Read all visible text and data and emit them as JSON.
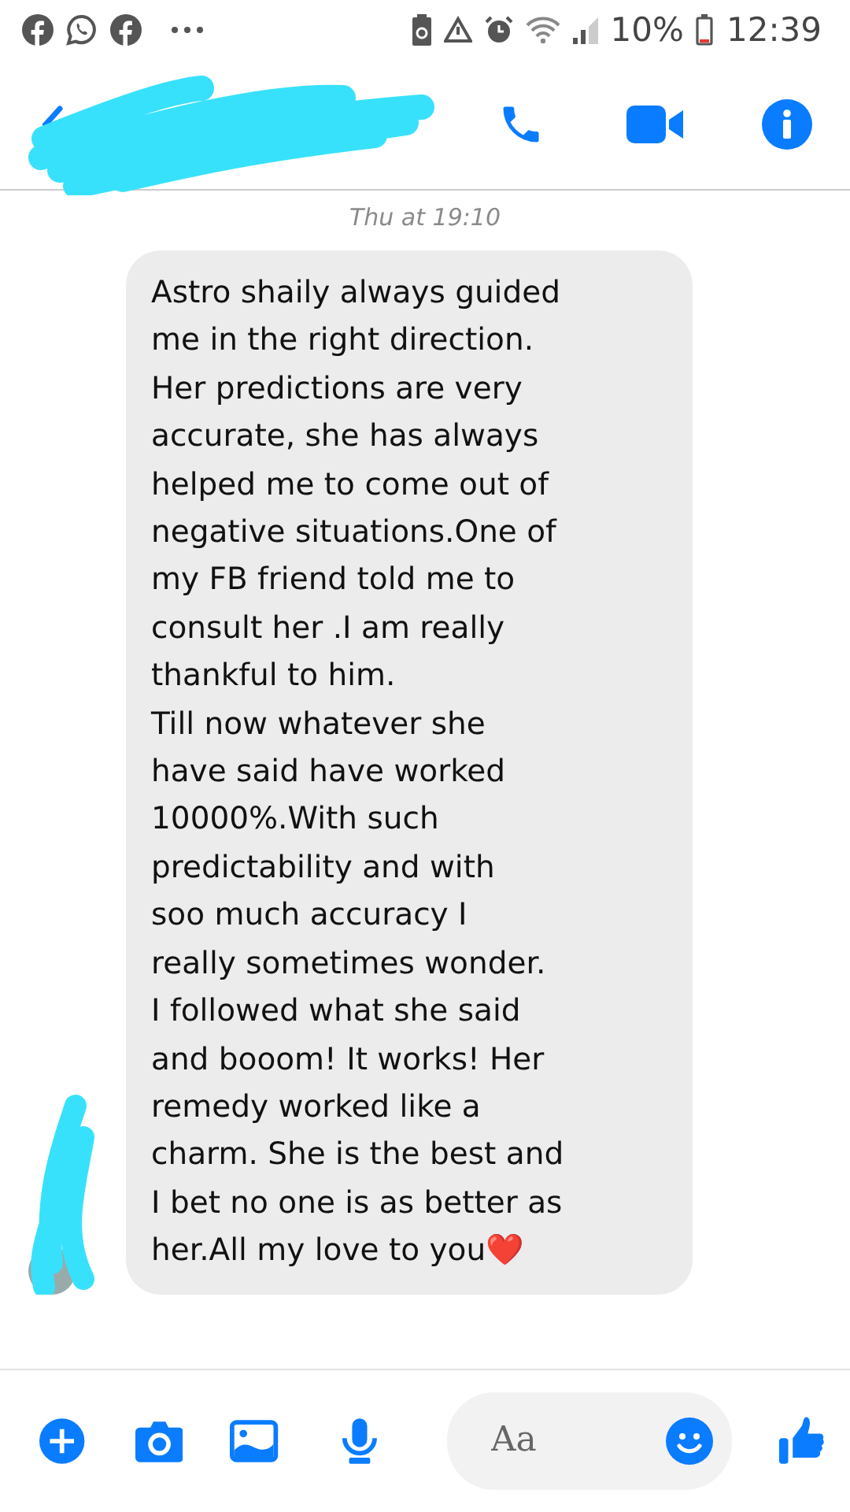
{
  "status_bar": {
    "battery_percent": "10%",
    "time": "12:39"
  },
  "header": {
    "name_redacted": true
  },
  "timestamp": "Thu at 19:10",
  "message": {
    "text": "Astro shaily always guided\nme in the right direction.\nHer predictions are very\naccurate, she has always\nhelped me to come out of\nnegative situations.One of\nmy FB friend told me to\nconsult her .I am really\nthankful to him.\nTill now whatever she\nhave said have worked\n10000%.With such\npredictability and with\nsoo much accuracy I\nreally sometimes wonder.\nI followed what she said\nand booom! It works! Her\nremedy worked like a\ncharm. She is the best and\nI bet no one is as better as\nher.All my love to you❤️"
  },
  "composer": {
    "placeholder": "Aa"
  }
}
